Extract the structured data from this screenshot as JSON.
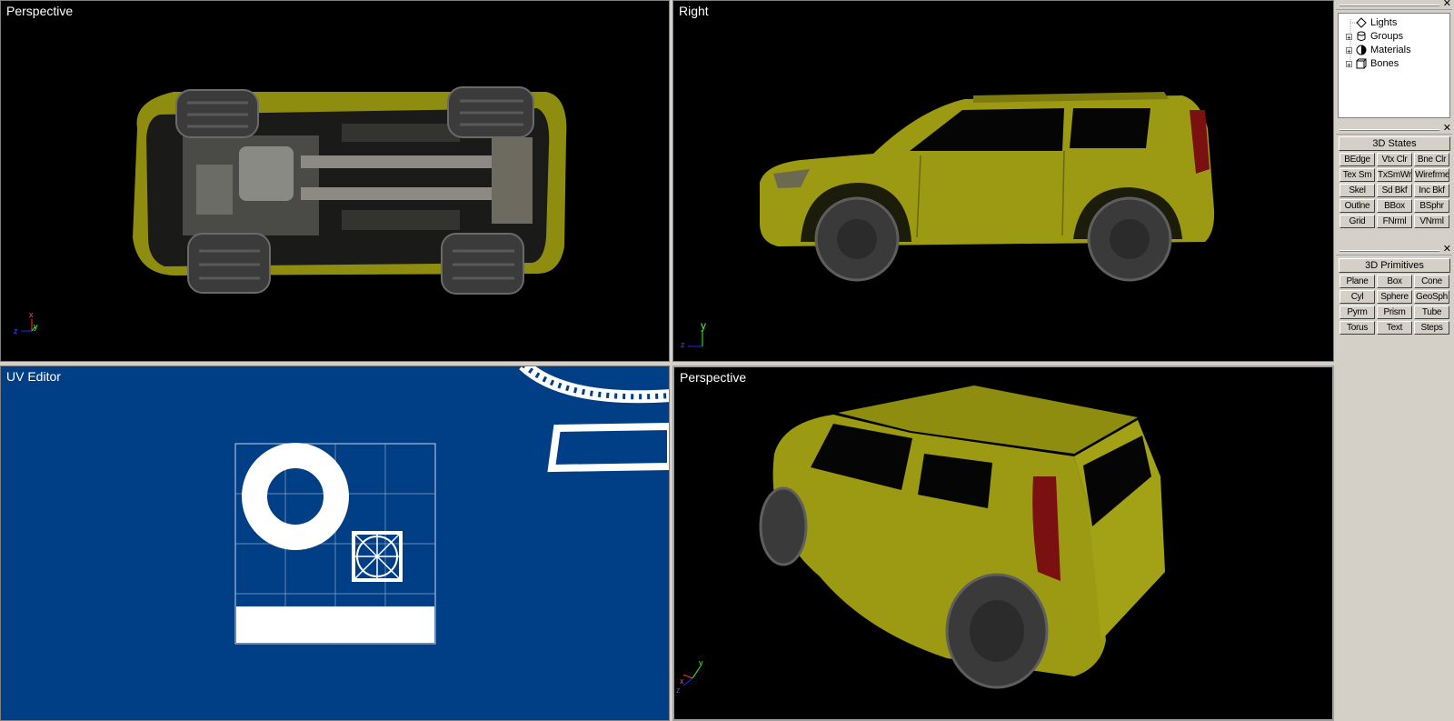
{
  "viewports": {
    "top_left": {
      "title": "Perspective"
    },
    "top_right": {
      "title": "Right"
    },
    "bottom_left": {
      "title": "UV Editor"
    },
    "bottom_right": {
      "title": "Perspective"
    }
  },
  "axis_labels": {
    "top_left": {
      "x": "x",
      "y": "y",
      "z": "z"
    },
    "top_right": {
      "y": "y",
      "z": "z"
    },
    "bottom_right": {
      "x": "x",
      "y": "y",
      "z": "z"
    }
  },
  "tree": {
    "items": [
      {
        "label": "Lights",
        "icon": "light-icon"
      },
      {
        "label": "Groups",
        "icon": "groups-icon"
      },
      {
        "label": "Materials",
        "icon": "materials-icon"
      },
      {
        "label": "Bones",
        "icon": "bones-icon"
      }
    ]
  },
  "states_panel": {
    "header": "3D States",
    "buttons": [
      "BEdge",
      "Vtx Clr",
      "Bne Clr",
      "Tex Sm",
      "TxSmWr",
      "Wirefrme",
      "Skel",
      "Sd Bkf",
      "Inc Bkf",
      "Outlne",
      "BBox",
      "BSphr",
      "Grid",
      "FNrml",
      "VNrml"
    ]
  },
  "primitives_panel": {
    "header": "3D Primitives",
    "buttons": [
      "Plane",
      "Box",
      "Cone",
      "Cyl",
      "Sphere",
      "GeoSph",
      "Pyrm",
      "Prism",
      "Tube",
      "Torus",
      "Text",
      "Steps"
    ]
  },
  "colors": {
    "car_body": "#9c9a12",
    "uv_background": "#003e86",
    "viewport_background": "#000000",
    "panel_background": "#d4d0c8"
  }
}
